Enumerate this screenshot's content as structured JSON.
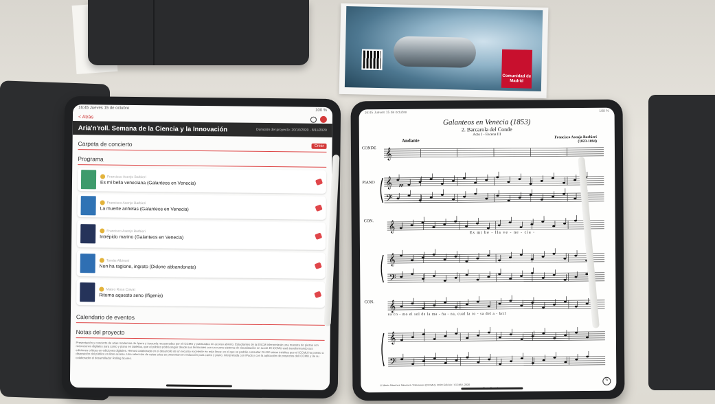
{
  "flyer": {
    "logo_text": "Comunidad de Madrid"
  },
  "left_app": {
    "status_left": "16:45  Jueves 15 de octubre",
    "status_right": "100 %",
    "back_label": "< Atrás",
    "title": "Aria'n'roll. Semana de la Ciencia y la Innovación",
    "dates": "Duración del proyecto: 20/10/2020 - 8/11/2020",
    "folder_header": "Carpeta de concierto",
    "create_label": "Crear",
    "program_header": "Programa",
    "pieces": [
      {
        "composer": "Francisco Asenjo Barbieri",
        "title": "Es mi bella veneciana (Galanteos en Venecia)",
        "cover_color": "#3e9b6c"
      },
      {
        "composer": "Francisco Asenjo Barbieri",
        "title": "La muerte anhelas (Galanteos en Venecia)",
        "cover_color": "#2f73b5"
      },
      {
        "composer": "Francisco Asenjo Barbieri",
        "title": "Intrépido marino (Galanteos en Venecia)",
        "cover_color": "#25335a"
      },
      {
        "composer": "Tomás Albinoni",
        "title": "Non ha ragione, ingrato (Didone abbandonata)",
        "cover_color": "#2f6fb3"
      },
      {
        "composer": "Mateo Rosa Ciavat",
        "title": "Ritorna aquesto seno (Ifigenia)",
        "cover_color": "#25335a"
      }
    ],
    "calendar_header": "Calendario de eventos",
    "notes_header": "Notas del proyecto",
    "notes_text": "Presentación y concierto de arias modernas de ópera y zarzuela recuperadas por el ICCMU y publicadas en acceso abierto. Estudiantes de la ESCM interpretarán una muestra de piezas con reducciones digitales para canto y piano en tabletas, que el público podrá seguir desde sus terminales con un nuevo sistema de visualización en scroll. El ICCMU está transformando sus ediciones críticas en ediciones digitales. Hemos colaborado en el desarrollo de un recurso excelente en esta línea: en el que se podrán consultar 20.000 obras inéditas que el ICCMU ha puesto a disposición del público en libre acceso. Una selección de estas arias se presentan en reducción para canto y piano, interpretada con iPads y con la aplicación de proyectos del ICCMU y de su colaborador el desarrollador Rolling Scores."
  },
  "right_app": {
    "status_left": "16:45  Jueves 15 de octubre",
    "status_right": "100 %",
    "score_title": "Galanteos en Venecia (1853)",
    "score_subtitle": "2. Barcarola del Conde",
    "score_act": "Acto I - Escena III",
    "tempo": "Andante",
    "composer": "Francisco Asenjo Barbieri",
    "composer_dates": "(1823-1894)",
    "label_conde": "CONDE",
    "label_piano": "PIANO",
    "label_con": "CON.",
    "dynamic": "pp",
    "lyrics_1": "Es  mi  be - lla  ve - ne - cia -",
    "lyrics_2": "na     co - mo  el   sol   de   la    ma - ña - na,   cual   la   ro - sa  del   a - bril",
    "copyright": "© Mario Sánchez Sánchez / Ediciones (ICCMU), 2020 Edición / ICCMU, 2020",
    "page_footer": "Tema Escuela"
  }
}
